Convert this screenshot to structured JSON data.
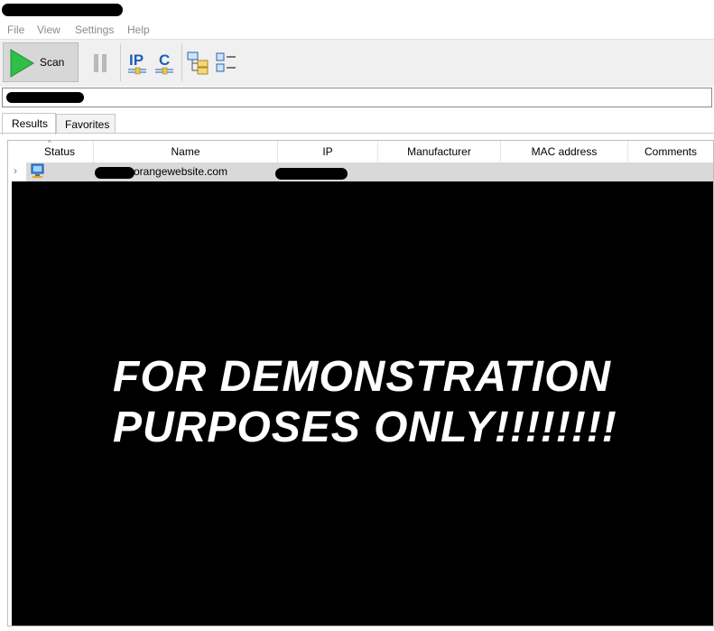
{
  "window": {
    "title_redacted": true
  },
  "menu": {
    "items": [
      {
        "label": "File"
      },
      {
        "label": "View"
      },
      {
        "label": "Settings"
      },
      {
        "label": "Help"
      }
    ]
  },
  "toolbar": {
    "scan_label": "Scan",
    "icons": [
      "play-icon",
      "pause-icon",
      "ip-icon",
      "c-icon",
      "network-tree-icon",
      "list-view-icon"
    ]
  },
  "address": {
    "value_redacted": true
  },
  "tabs": [
    {
      "label": "Results",
      "selected": true
    },
    {
      "label": "Favorites",
      "selected": false
    }
  ],
  "table": {
    "columns": [
      "Status",
      "Name",
      "IP",
      "Manufacturer",
      "MAC address",
      "Comments"
    ],
    "sorted_column": "Status",
    "rows": [
      {
        "status_icon": "computer-icon",
        "name_visible": "orangewebsite.com",
        "name_prefix_redacted": true,
        "ip_redacted": true,
        "manufacturer": "",
        "mac": "",
        "comments": ""
      }
    ]
  },
  "overlay": {
    "line1": "FOR DEMONSTRATION",
    "line2": "PURPOSES ONLY!!!!!!!!"
  },
  "colors": {
    "play_green": "#2fbf4a",
    "icon_blue": "#1f5fb5",
    "folder_yellow": "#e9c64a",
    "overlay_bg": "#000000",
    "overlay_text": "#ffffff"
  }
}
